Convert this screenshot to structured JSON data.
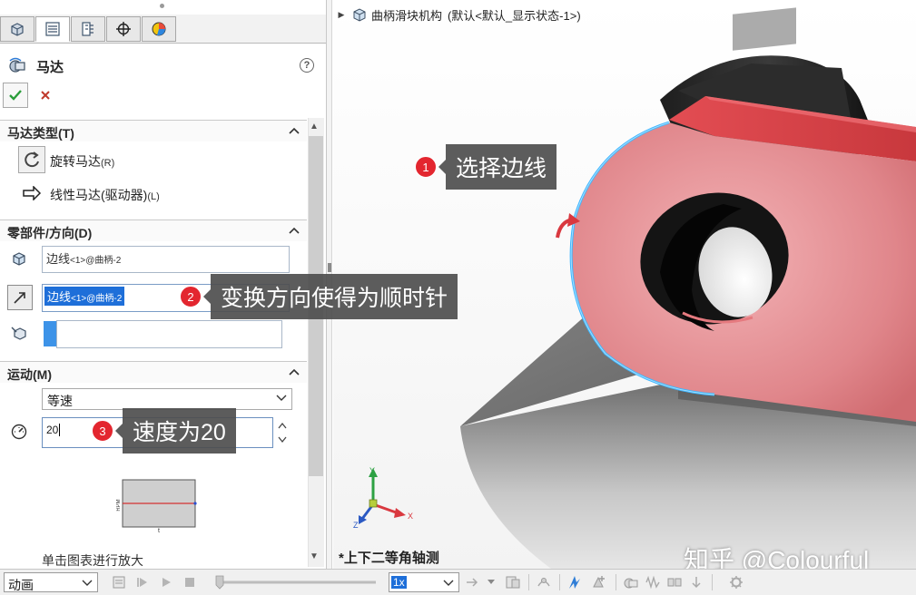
{
  "tree": {
    "assembly_name": "曲柄滑块机构",
    "config": "(默认<默认_显示状态-1>)"
  },
  "property_manager": {
    "title": "马达",
    "help": "?"
  },
  "motor_type": {
    "header": "马达类型(T)",
    "rotary_label": "旋转马达",
    "rotary_key": "(R)",
    "linear_label": "线性马达(驱动器)",
    "linear_key": "(L)"
  },
  "component_direction": {
    "header": "零部件/方向(D)",
    "edge_field_1_name": "边线",
    "edge_field_1_suffix": "<1>@曲柄-2",
    "edge_field_2_name": "边线",
    "edge_field_2_suffix": "<1>@曲柄-2"
  },
  "motion": {
    "header": "运动(M)",
    "type_value": "等速",
    "speed_value": "20",
    "chart_y_label": "RPM",
    "chart_x_label": "t",
    "zoom_hint": "单击图表进行放大"
  },
  "annotations": {
    "step1_number": "1",
    "step1_text": "选择边线",
    "step2_number": "2",
    "step2_text": "变换方向使得为顺时针",
    "step3_number": "3",
    "step3_text": "速度为20"
  },
  "viewport": {
    "view_name": "*上下二等角轴测",
    "watermark": "知乎 @Colourful",
    "axis_x": "X",
    "axis_y": "Y",
    "axis_z": "Z"
  },
  "bottom_toolbar": {
    "study_type": "动画",
    "playback_rate": "1x"
  },
  "colors": {
    "selected_part": "#d9454a",
    "selection_edge": "#3fb6ff",
    "callout_badge": "#e3262f",
    "callout_bubble": "#4e4e4e",
    "highlight_blue": "#1e6fd9"
  }
}
